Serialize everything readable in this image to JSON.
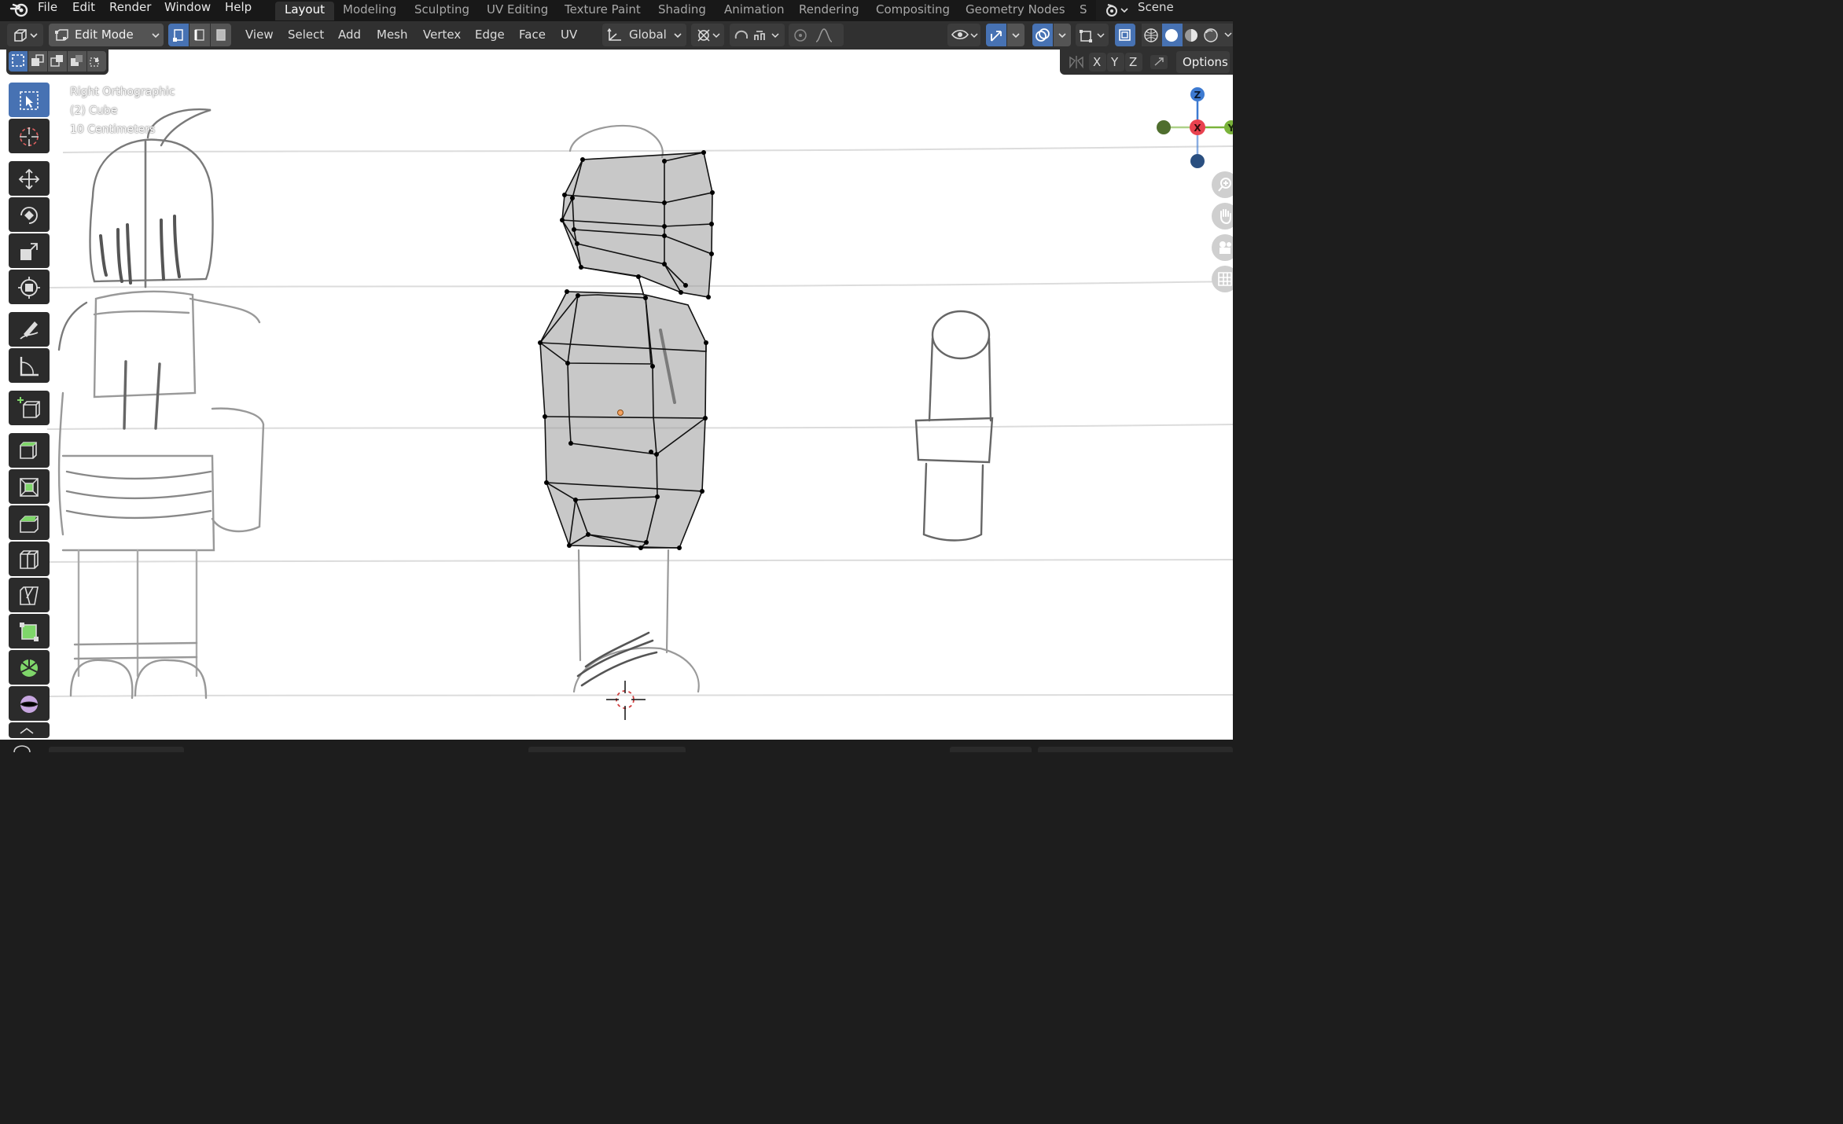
{
  "menu": [
    "File",
    "Edit",
    "Render",
    "Window",
    "Help"
  ],
  "workspaces": [
    {
      "label": "Layout",
      "active": true
    },
    {
      "label": "Modeling",
      "active": false
    },
    {
      "label": "Sculpting",
      "active": false
    },
    {
      "label": "UV Editing",
      "active": false
    },
    {
      "label": "Texture Paint",
      "active": false
    },
    {
      "label": "Shading",
      "active": false
    },
    {
      "label": "Animation",
      "active": false
    },
    {
      "label": "Rendering",
      "active": false
    },
    {
      "label": "Compositing",
      "active": false
    },
    {
      "label": "Geometry Nodes",
      "active": false
    },
    {
      "label": "S",
      "active": false
    }
  ],
  "scene": {
    "label": "Scene"
  },
  "header": {
    "mode": "Edit Mode",
    "menus": [
      "View",
      "Select",
      "Add",
      "Mesh",
      "Vertex",
      "Edge",
      "Face",
      "UV"
    ],
    "transform_orientation": "Global"
  },
  "subheader": {
    "axes": [
      "X",
      "Y",
      "Z"
    ],
    "options": "Options"
  },
  "viewport": {
    "view_name": "Right Orthographic",
    "object": "(2) Cube",
    "scale": "10 Centimeters"
  },
  "gizmo": {
    "z": "Z",
    "x": "X",
    "y": "Y"
  },
  "toolbar": [
    "select-box",
    "cursor",
    "move",
    "rotate",
    "scale",
    "transform",
    "annotate",
    "measure",
    "add-cube",
    "extrude-region",
    "inset-faces",
    "bevel",
    "loop-cut",
    "knife",
    "poly-build",
    "spin",
    "smooth",
    "shrink-fatten"
  ],
  "colors": {
    "accent": "#4772b3",
    "header": "#303030",
    "topbar": "#181818",
    "gizmo_x": "#e8424f",
    "gizmo_y": "#7ab33a",
    "gizmo_z": "#3d7ad1"
  }
}
